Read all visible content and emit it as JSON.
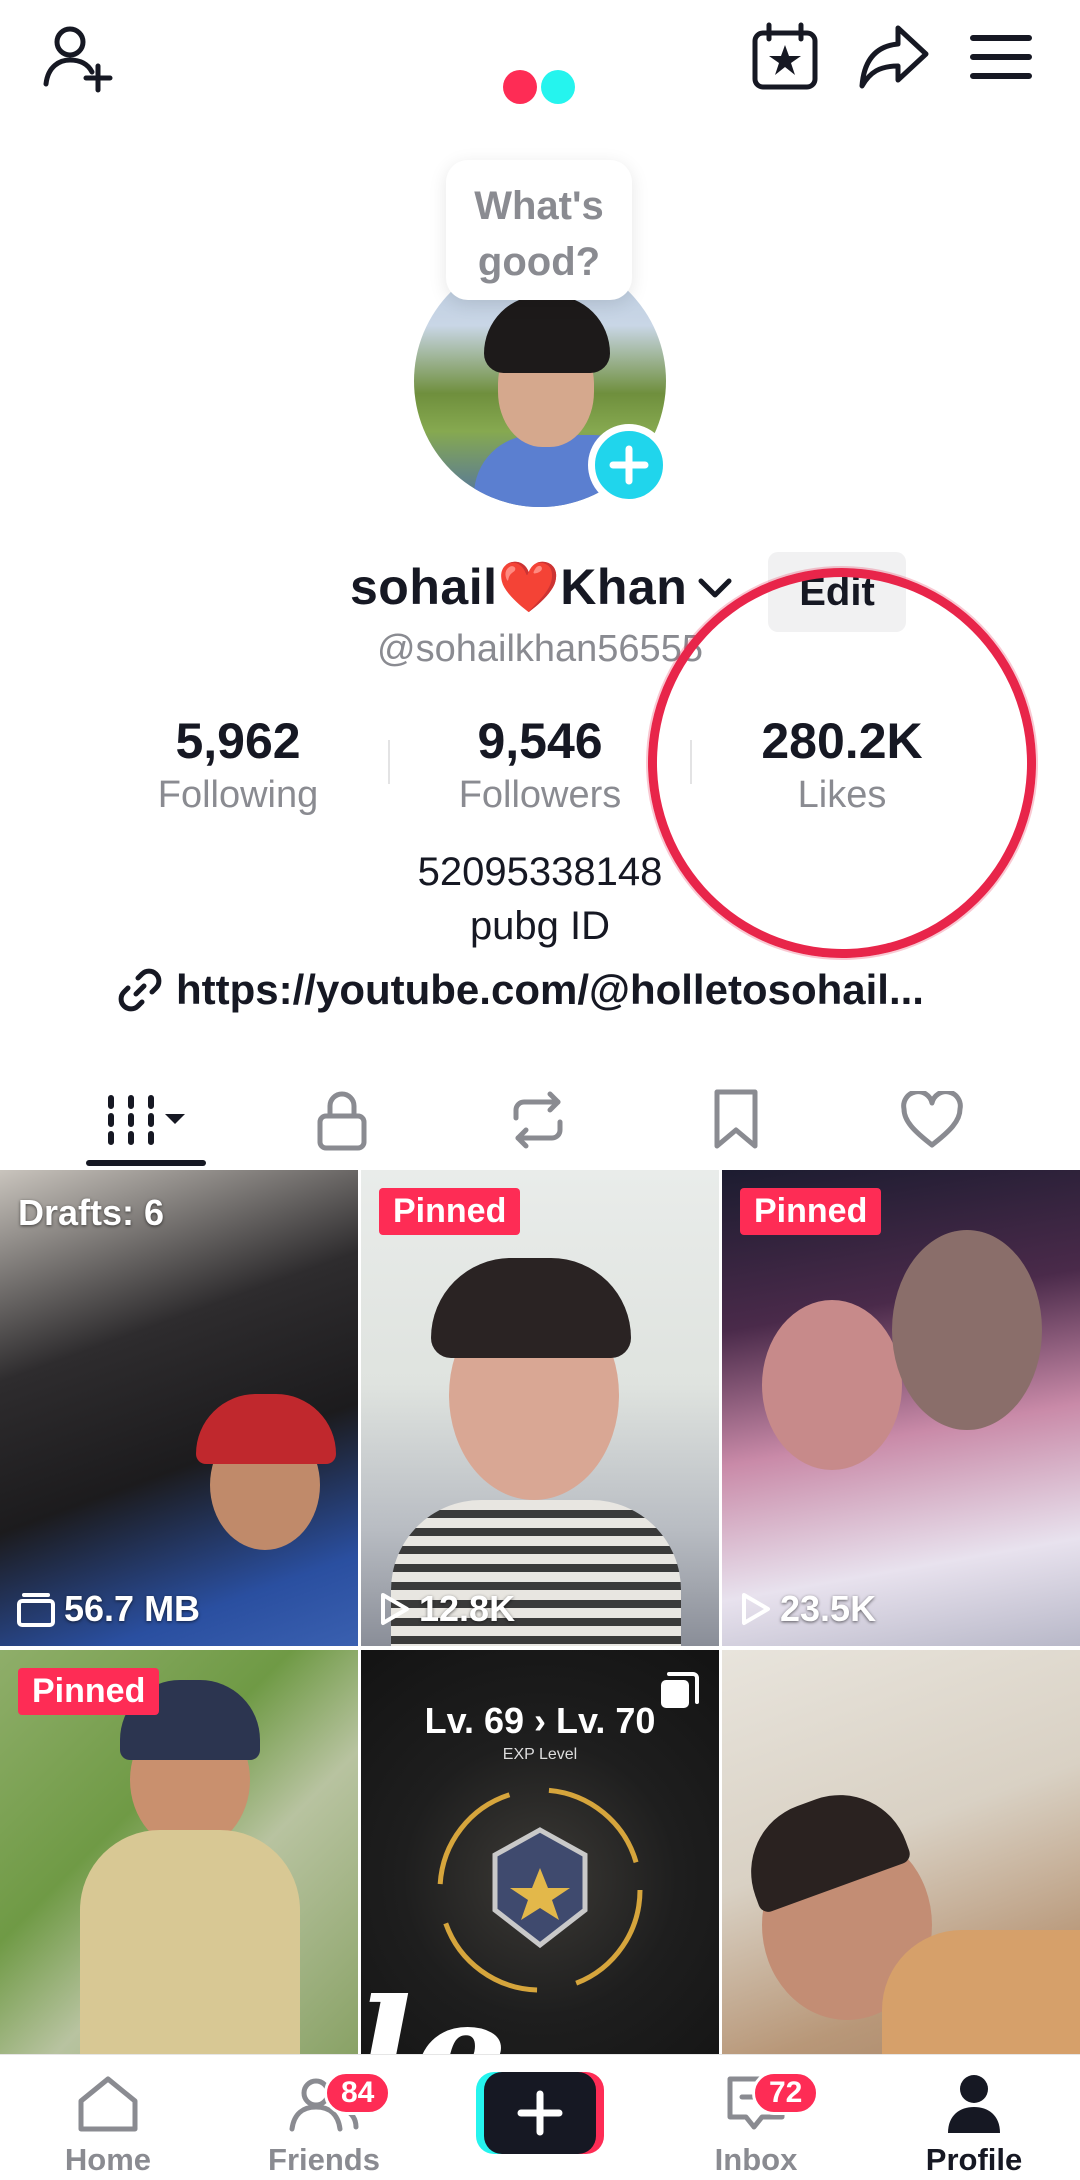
{
  "header": {
    "add_friend_icon": "person-add-icon",
    "calendar_icon": "calendar-star-icon",
    "share_icon": "share-arrow-icon",
    "menu_icon": "hamburger-menu-icon"
  },
  "profile": {
    "bubble_line1": "What's",
    "bubble_line2": "good?",
    "name": "sohail❤️Khan",
    "edit_label": "Edit",
    "handle": "@sohailkhan56555",
    "stats": {
      "following_count": "5,962",
      "following_label": "Following",
      "followers_count": "9,546",
      "followers_label": "Followers",
      "likes_count": "280.2K",
      "likes_label": "Likes"
    },
    "bio_line1": "52095338148",
    "bio_line2": "pubg ID",
    "link": "https://youtube.com/@holletosohail..."
  },
  "tabs": [
    "videos",
    "private",
    "reposts",
    "favorites",
    "liked"
  ],
  "grid": [
    {
      "label": "Drafts: 6",
      "stat": "56.7 MB"
    },
    {
      "label": "Pinned",
      "stat": "12.8K"
    },
    {
      "label": "Pinned",
      "stat": "23.5K"
    },
    {
      "label": "Pinned",
      "stat": ""
    },
    {
      "level_text": "Lv. 69 › Lv. 70",
      "level_sub": "EXP Level",
      "overlay": "le"
    },
    {
      "label": "",
      "stat": ""
    }
  ],
  "bottom_nav": {
    "home": "Home",
    "friends": "Friends",
    "friends_badge": "84",
    "inbox": "Inbox",
    "inbox_badge": "72",
    "profile": "Profile"
  },
  "colors": {
    "accent": "#fe2c55",
    "cyan": "#25f4ee",
    "text": "#161823",
    "muted": "#8a8b91"
  }
}
